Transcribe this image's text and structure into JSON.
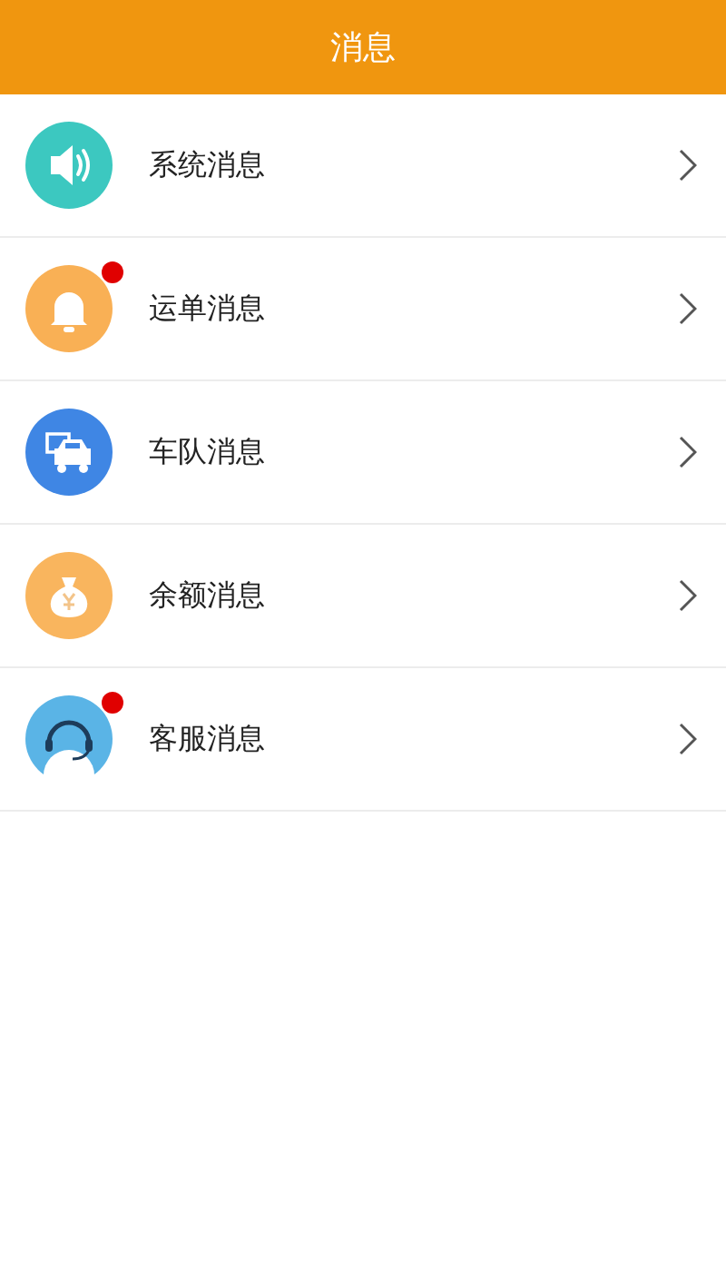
{
  "header": {
    "title": "消息"
  },
  "items": [
    {
      "label": "系统消息",
      "kind": "speaker",
      "color": "#3cc8c0",
      "unread": false
    },
    {
      "label": "运单消息",
      "kind": "bell",
      "color": "#f9b055",
      "unread": true
    },
    {
      "label": "车队消息",
      "kind": "trucks",
      "color": "#3f86e4",
      "unread": false
    },
    {
      "label": "余额消息",
      "kind": "moneybag",
      "color": "#f9b55e",
      "unread": false
    },
    {
      "label": "客服消息",
      "kind": "headset",
      "color": "#5ab4e6",
      "unread": true
    }
  ]
}
